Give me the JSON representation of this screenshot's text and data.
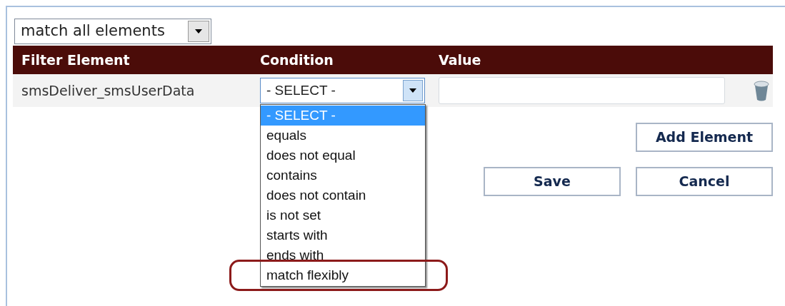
{
  "match_select": {
    "value": "match all elements"
  },
  "table": {
    "columns": [
      "Filter Element",
      "Condition",
      "Value"
    ],
    "rows": [
      {
        "filter_element": "smsDeliver_smsUserData",
        "condition": "- SELECT -",
        "value": ""
      }
    ]
  },
  "condition_dropdown": {
    "expanded": true,
    "options": [
      {
        "label": "- SELECT -",
        "selected": true,
        "circled": false
      },
      {
        "label": "equals",
        "selected": false,
        "circled": false
      },
      {
        "label": "does not equal",
        "selected": false,
        "circled": false
      },
      {
        "label": "contains",
        "selected": false,
        "circled": false
      },
      {
        "label": "does not contain",
        "selected": false,
        "circled": false
      },
      {
        "label": "is not set",
        "selected": false,
        "circled": false
      },
      {
        "label": "starts with",
        "selected": false,
        "circled": false
      },
      {
        "label": "ends with",
        "selected": false,
        "circled": false
      },
      {
        "label": "match flexibly",
        "selected": false,
        "circled": true
      }
    ]
  },
  "buttons": {
    "add": "Add Element",
    "save": "Save",
    "cancel": "Cancel"
  }
}
